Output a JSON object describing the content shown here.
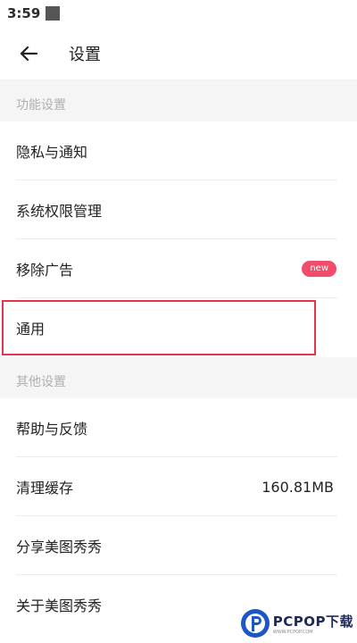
{
  "status_bar": {
    "time": "3:59"
  },
  "app_bar": {
    "title": "设置"
  },
  "sections": {
    "function_settings": {
      "header": "功能设置",
      "items": [
        {
          "label": "隐私与通知"
        },
        {
          "label": "系统权限管理"
        },
        {
          "label": "移除广告",
          "badge": "new"
        },
        {
          "label": "通用"
        }
      ]
    },
    "other_settings": {
      "header": "其他设置",
      "items": [
        {
          "label": "帮助与反馈"
        },
        {
          "label": "清理缓存",
          "value": "160.81MB"
        },
        {
          "label": "分享美图秀秀"
        },
        {
          "label": "关于美图秀秀"
        }
      ]
    }
  },
  "watermark": {
    "brand": "PCPOP下载",
    "sub": "WWW.PCPOP.COM"
  },
  "colors": {
    "highlight_outline": "#e8344a",
    "badge": "#f24b6b",
    "section_bg": "#f5f5f5",
    "section_text": "#b0b0b0"
  }
}
